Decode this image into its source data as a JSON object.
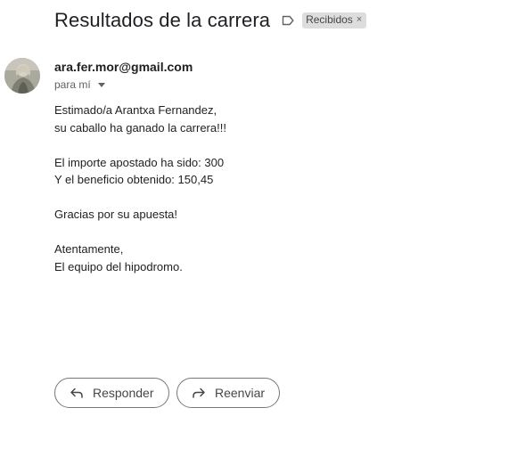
{
  "email": {
    "subject": "Resultados de la carrera",
    "label": "Recibidos",
    "label_remove": "×",
    "sender": "ara.fer.mor@gmail.com",
    "to": "para mí",
    "body": {
      "greeting": "Estimado/a Arantxa Fernandez,",
      "line1": "su caballo ha ganado la carrera!!!",
      "amount": "El importe apostado ha sido: 300",
      "profit": "Y el beneficio obtenido: 150,45",
      "thanks": "Gracias por su apuesta!",
      "closing": "Atentamente,",
      "signature": "El equipo del hipodromo."
    }
  },
  "actions": {
    "reply": "Responder",
    "forward": "Reenviar"
  },
  "icons": {
    "label": "label-outline-icon",
    "reply": "reply-icon",
    "forward": "forward-icon",
    "caret": "caret-down-icon"
  }
}
